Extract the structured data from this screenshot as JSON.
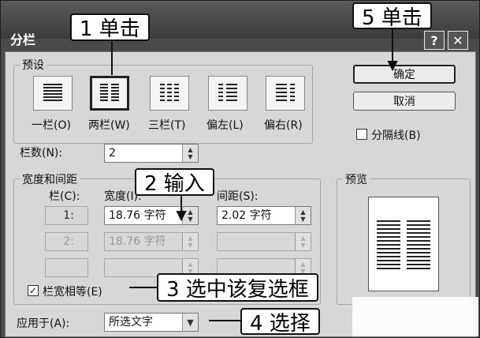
{
  "dialog": {
    "title": "分栏",
    "help_glyph": "?",
    "close_glyph": "✕"
  },
  "presets": {
    "group_label": "预设",
    "items": [
      {
        "label": "一栏(O)",
        "icon": "one-column-icon"
      },
      {
        "label": "两栏(W)",
        "icon": "two-columns-icon",
        "selected": true
      },
      {
        "label": "三栏(T)",
        "icon": "three-columns-icon"
      },
      {
        "label": "偏左(L)",
        "icon": "left-column-icon"
      },
      {
        "label": "偏右(R)",
        "icon": "right-column-icon"
      }
    ]
  },
  "buttons": {
    "ok": "确定",
    "cancel": "取消"
  },
  "separator": {
    "label": "分隔线(B)",
    "checked": false
  },
  "column_count": {
    "label": "栏数(N):",
    "value": "2"
  },
  "width_spacing": {
    "group_label": "宽度和间距",
    "col_header": "栏(C):",
    "width_header": "宽度(I):",
    "spacing_header": "间距(S):",
    "rows": [
      {
        "col": "1:",
        "width": "18.76 字符",
        "spacing": "2.02 字符",
        "enabled": true
      },
      {
        "col": "2:",
        "width": "18.76 字符",
        "spacing": "",
        "enabled": false
      },
      {
        "col": "",
        "width": "",
        "spacing": "",
        "enabled": false
      }
    ],
    "equal_width": {
      "label": "栏宽相等(E)",
      "checked": true
    }
  },
  "apply_to": {
    "label": "应用于(A):",
    "value": "所选文字"
  },
  "preview": {
    "label": "预览"
  },
  "callouts": {
    "c1": "1 单击",
    "c2": "2 输入",
    "c3": "3 选中该复选框",
    "c4": "4 选择",
    "c5": "5 单击"
  },
  "colors": {
    "title_bar": "#3b3b3b",
    "dialog_bg": "#d7d7d7"
  }
}
